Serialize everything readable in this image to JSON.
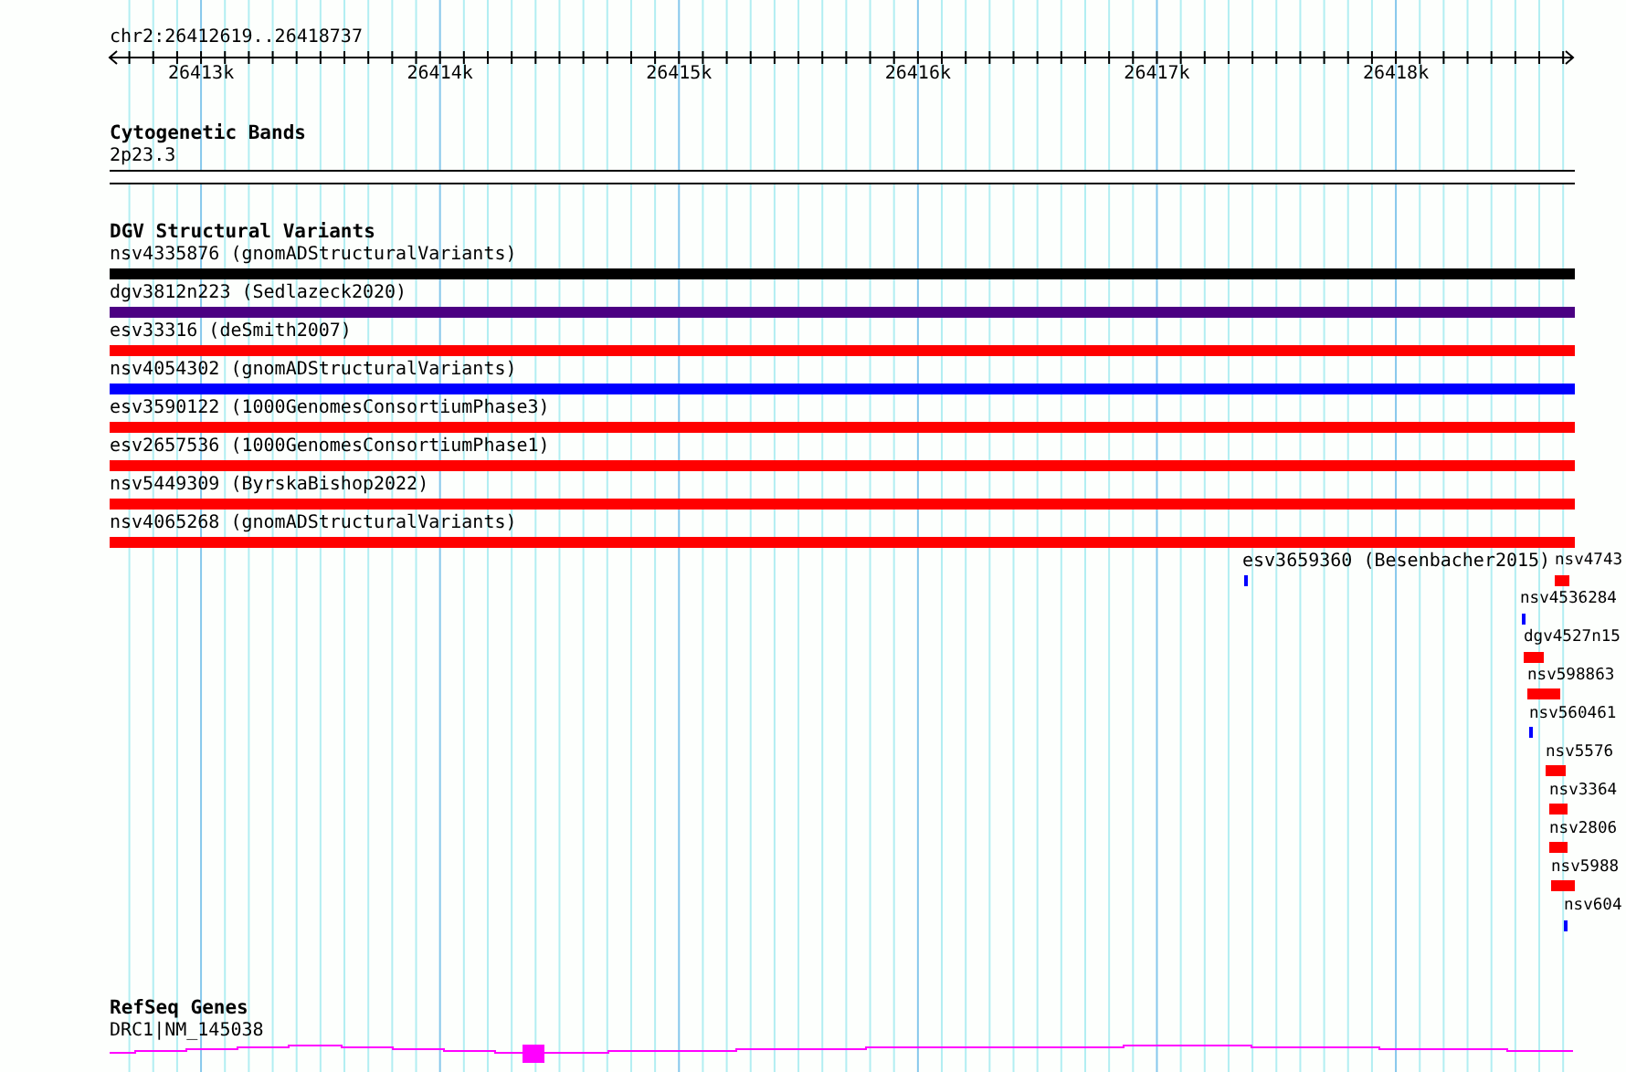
{
  "ruler": {
    "region": "chr2:26412619..26418737",
    "ticks": [
      "26413k",
      "26414k",
      "26415k",
      "26416k",
      "26417k",
      "26418k"
    ]
  },
  "tracks": [
    {
      "title": "Cytogenetic Bands",
      "kind": "bands",
      "features": [
        {
          "label": "2p23.3"
        }
      ]
    },
    {
      "title": "DGV Structural Variants",
      "kind": "variants",
      "features": [
        {
          "label": "nsv4335876 (gnomADStructuralVariants)",
          "color": "#000000"
        },
        {
          "label": "dgv3812n223 (Sedlazeck2020)",
          "color": "#4b0082"
        },
        {
          "label": "esv33316 (deSmith2007)",
          "color": "#ff0000"
        },
        {
          "label": "nsv4054302 (gnomADStructuralVariants)",
          "color": "#0000ff"
        },
        {
          "label": "esv3590122 (1000GenomesConsortiumPhase3)",
          "color": "#ff0000"
        },
        {
          "label": "esv2657536 (1000GenomesConsortiumPhase1)",
          "color": "#ff0000"
        },
        {
          "label": "nsv5449309 (ByrskaBishop2022)",
          "color": "#ff0000"
        },
        {
          "label": "nsv4065268 (gnomADStructuralVariants)",
          "color": "#ff0000"
        },
        {
          "label": "esv3659360 (Besenbacher2015)",
          "color": "#0000ff"
        },
        {
          "label": "nsv4743",
          "color": "#ff0000"
        },
        {
          "label": "nsv4536284",
          "color": "#0000ff"
        },
        {
          "label": "dgv4527n15",
          "color": "#ff0000"
        },
        {
          "label": "nsv598863",
          "color": "#ff0000"
        },
        {
          "label": "nsv560461",
          "color": "#0000ff"
        },
        {
          "label": "nsv5576",
          "color": "#ff0000"
        },
        {
          "label": "nsv3364",
          "color": "#ff0000"
        },
        {
          "label": "nsv2806",
          "color": "#ff0000"
        },
        {
          "label": "nsv5988",
          "color": "#ff0000"
        },
        {
          "label": "nsv604",
          "color": "#0000ff"
        }
      ]
    },
    {
      "title": "RefSeq Genes",
      "kind": "genes",
      "features": [
        {
          "label": "DRC1|NM_145038",
          "color": "#ff00ff"
        }
      ]
    }
  ]
}
